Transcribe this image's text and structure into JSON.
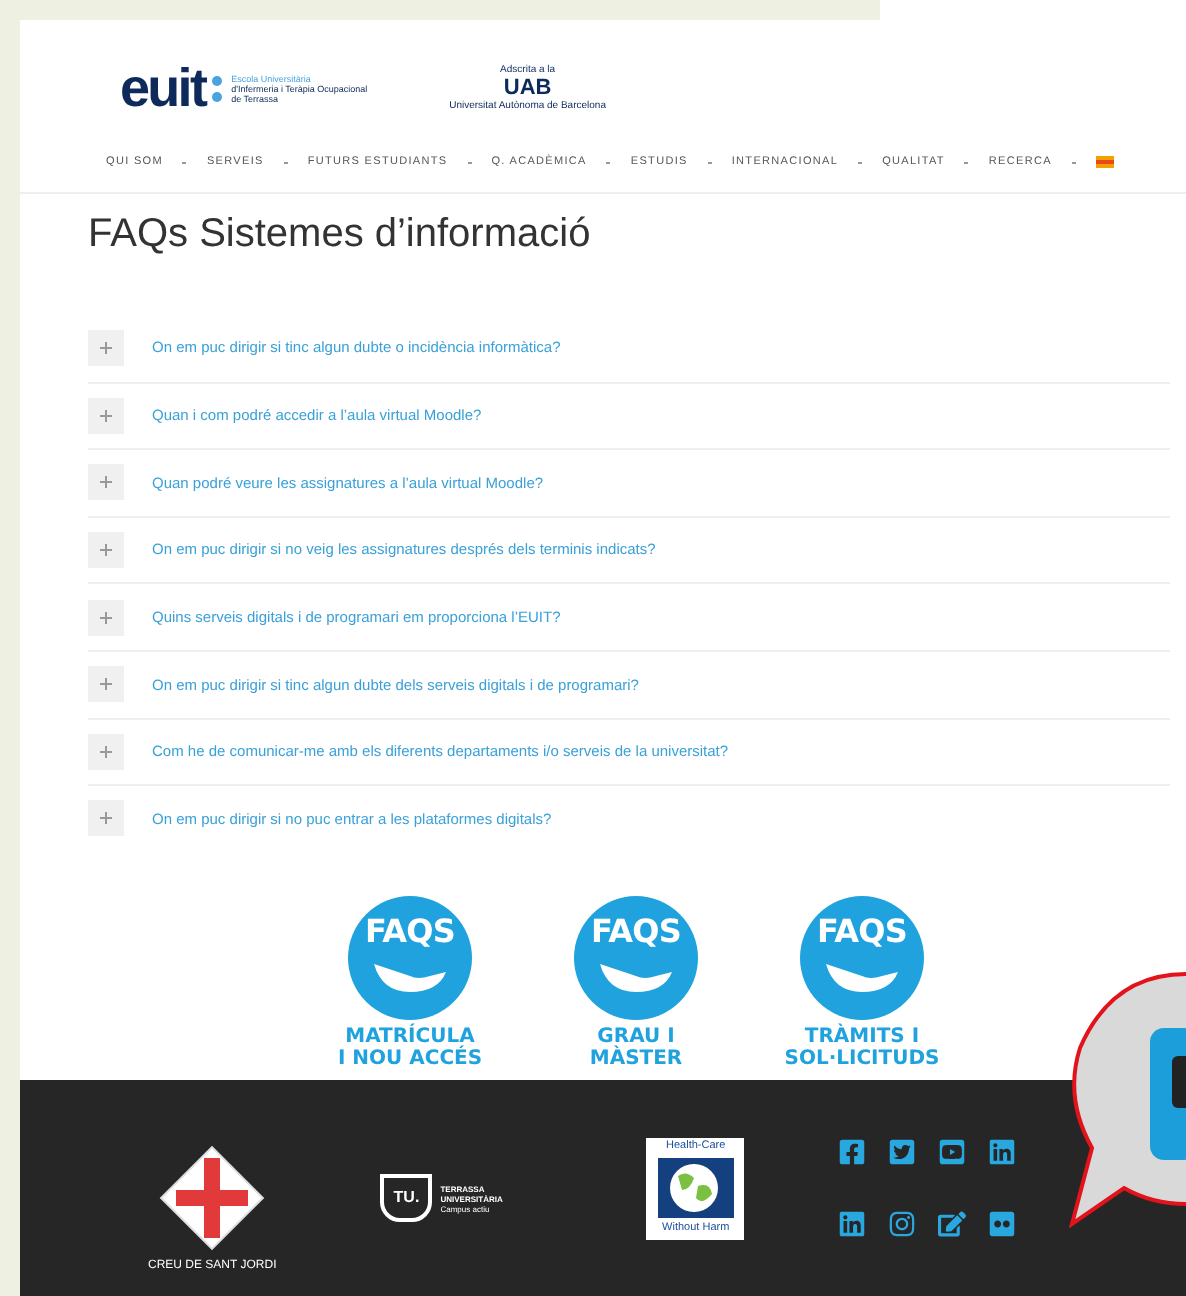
{
  "header": {
    "logo_text": "euit",
    "school_name": [
      "Escola Universitària",
      "d'Infermeria i Teràpia Ocupacional",
      "de Terrassa"
    ],
    "affiliation": {
      "top": "Adscrita a la",
      "name": "UAB",
      "bottom": "Universitat Autònoma de Barcelona"
    }
  },
  "nav": {
    "items": [
      "QUI SOM",
      "SERVEIS",
      "FUTURS ESTUDIANTS",
      "Q. ACADÈMICA",
      "ESTUDIS",
      "INTERNACIONAL",
      "QUALITAT",
      "RECERCA"
    ]
  },
  "page_title": "FAQs Sistemes d’informació",
  "faqs": [
    {
      "question": "On em puc dirigir si tinc algun dubte o incidència informàtica?",
      "expanded": false
    },
    {
      "question": "Quan i com podré accedir a l’aula virtual Moodle?",
      "expanded": false
    },
    {
      "question": "Quan podré veure les assignatures a l’aula virtual Moodle?",
      "expanded": false
    },
    {
      "question": "On em puc dirigir si no veig les assignatures després dels terminis indicats?",
      "expanded": false
    },
    {
      "question": "Quins serveis digitals i de programari em proporciona l’EUIT?",
      "expanded": false
    },
    {
      "question": "On em puc dirigir si tinc algun dubte dels serveis digitals i de programari?",
      "expanded": false
    },
    {
      "question": "Com he de comunicar-me amb els diferents departaments i/o serveis de la universitat?",
      "expanded": false
    },
    {
      "question": "On em puc dirigir si no puc entrar a les plataformes digitals?",
      "expanded": false
    }
  ],
  "faq_badges": [
    {
      "badge": "FAQS",
      "lines": [
        "MATRÍCULA",
        "I NOU ACCÉS"
      ]
    },
    {
      "badge": "FAQS",
      "lines": [
        "GRAU I",
        "MÀSTER"
      ]
    },
    {
      "badge": "FAQS",
      "lines": [
        "TRÀMITS I",
        "SOL·LICITUDS"
      ]
    }
  ],
  "footer": {
    "creu": "CREU DE SANT JORDI",
    "tu": {
      "mark": "TU.",
      "name": [
        "TERRASSA",
        "UNIVERSITÀRIA"
      ],
      "tagline": "Campus actiu"
    },
    "hcwh": {
      "top": "Health-Care",
      "bottom": "Without Harm"
    },
    "social": [
      {
        "kind": "facebook"
      },
      {
        "kind": "twitter"
      },
      {
        "kind": "youtube"
      },
      {
        "kind": "linkedin"
      },
      {
        "kind": "linkedin"
      },
      {
        "kind": "instagram"
      },
      {
        "kind": "edit"
      },
      {
        "kind": "flickr"
      }
    ]
  }
}
